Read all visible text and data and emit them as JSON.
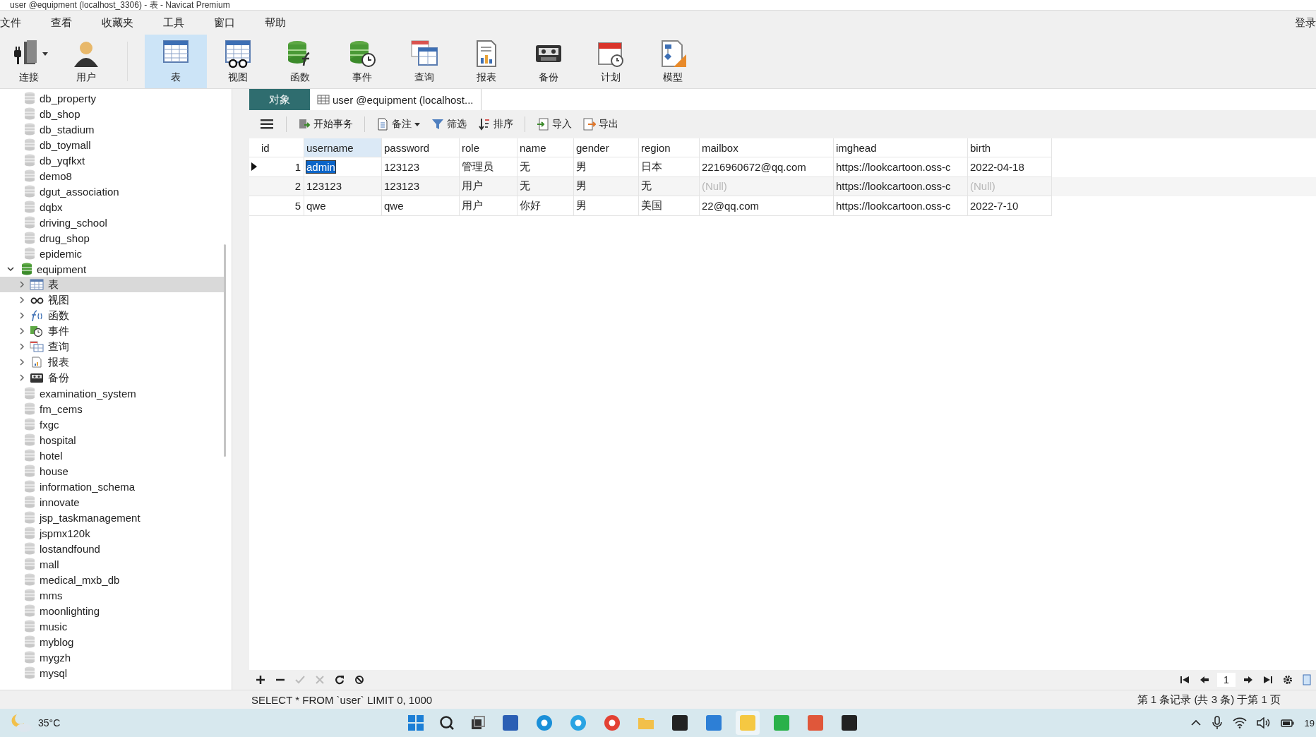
{
  "window": {
    "title": "user @equipment (localhost_3306) - 表 - Navicat Premium"
  },
  "menu": [
    "文件",
    "查看",
    "收藏夹",
    "工具",
    "窗口",
    "帮助"
  ],
  "login": "登录",
  "toolbar": [
    {
      "kind": "connect",
      "label": "连接",
      "selected": false,
      "dropdown": true
    },
    {
      "kind": "user",
      "label": "用户",
      "selected": false,
      "dropdown": false
    },
    {
      "kind": "table",
      "label": "表",
      "selected": true,
      "dropdown": false
    },
    {
      "kind": "view",
      "label": "视图",
      "selected": false,
      "dropdown": false
    },
    {
      "kind": "function",
      "label": "函数",
      "selected": false,
      "dropdown": false
    },
    {
      "kind": "event",
      "label": "事件",
      "selected": false,
      "dropdown": false
    },
    {
      "kind": "query",
      "label": "查询",
      "selected": false,
      "dropdown": false
    },
    {
      "kind": "report",
      "label": "报表",
      "selected": false,
      "dropdown": false
    },
    {
      "kind": "backup",
      "label": "备份",
      "selected": false,
      "dropdown": false
    },
    {
      "kind": "schedule",
      "label": "计划",
      "selected": false,
      "dropdown": false
    },
    {
      "kind": "model",
      "label": "模型",
      "selected": false,
      "dropdown": false
    }
  ],
  "sidebar": {
    "items": [
      {
        "label": "db_property",
        "kind": "db",
        "expanded": false,
        "selected": false
      },
      {
        "label": "db_shop",
        "kind": "db",
        "expanded": false,
        "selected": false
      },
      {
        "label": "db_stadium",
        "kind": "db",
        "expanded": false,
        "selected": false
      },
      {
        "label": "db_toymall",
        "kind": "db",
        "expanded": false,
        "selected": false
      },
      {
        "label": "db_yqfkxt",
        "kind": "db",
        "expanded": false,
        "selected": false
      },
      {
        "label": "demo8",
        "kind": "db",
        "expanded": false,
        "selected": false
      },
      {
        "label": "dgut_association",
        "kind": "db",
        "expanded": false,
        "selected": false
      },
      {
        "label": "dqbx",
        "kind": "db",
        "expanded": false,
        "selected": false
      },
      {
        "label": "driving_school",
        "kind": "db",
        "expanded": false,
        "selected": false
      },
      {
        "label": "drug_shop",
        "kind": "db",
        "expanded": false,
        "selected": false
      },
      {
        "label": "epidemic",
        "kind": "db",
        "expanded": false,
        "selected": false
      },
      {
        "label": "equipment",
        "kind": "db_open",
        "expanded": true,
        "selected": false,
        "children": [
          {
            "label": "表",
            "kind": "table",
            "expanded": false,
            "selected": true
          },
          {
            "label": "视图",
            "kind": "view",
            "expanded": false,
            "selected": false
          },
          {
            "label": "函数",
            "kind": "function",
            "expanded": false,
            "selected": false
          },
          {
            "label": "事件",
            "kind": "event",
            "expanded": false,
            "selected": false
          },
          {
            "label": "查询",
            "kind": "query",
            "expanded": false,
            "selected": false
          },
          {
            "label": "报表",
            "kind": "report",
            "expanded": false,
            "selected": false
          },
          {
            "label": "备份",
            "kind": "backup",
            "expanded": false,
            "selected": false
          }
        ]
      },
      {
        "label": "examination_system",
        "kind": "db",
        "expanded": false,
        "selected": false
      },
      {
        "label": "fm_cems",
        "kind": "db",
        "expanded": false,
        "selected": false
      },
      {
        "label": "fxgc",
        "kind": "db",
        "expanded": false,
        "selected": false
      },
      {
        "label": "hospital",
        "kind": "db",
        "expanded": false,
        "selected": false
      },
      {
        "label": "hotel",
        "kind": "db",
        "expanded": false,
        "selected": false
      },
      {
        "label": "house",
        "kind": "db",
        "expanded": false,
        "selected": false
      },
      {
        "label": "information_schema",
        "kind": "db",
        "expanded": false,
        "selected": false
      },
      {
        "label": "innovate",
        "kind": "db",
        "expanded": false,
        "selected": false
      },
      {
        "label": "jsp_taskmanagement",
        "kind": "db",
        "expanded": false,
        "selected": false
      },
      {
        "label": "jspmx120k",
        "kind": "db",
        "expanded": false,
        "selected": false
      },
      {
        "label": "lostandfound",
        "kind": "db",
        "expanded": false,
        "selected": false
      },
      {
        "label": "mall",
        "kind": "db",
        "expanded": false,
        "selected": false
      },
      {
        "label": "medical_mxb_db",
        "kind": "db",
        "expanded": false,
        "selected": false
      },
      {
        "label": "mms",
        "kind": "db",
        "expanded": false,
        "selected": false
      },
      {
        "label": "moonlighting",
        "kind": "db",
        "expanded": false,
        "selected": false
      },
      {
        "label": "music",
        "kind": "db",
        "expanded": false,
        "selected": false
      },
      {
        "label": "myblog",
        "kind": "db",
        "expanded": false,
        "selected": false
      },
      {
        "label": "mygzh",
        "kind": "db",
        "expanded": false,
        "selected": false
      },
      {
        "label": "mysql",
        "kind": "db",
        "expanded": false,
        "selected": false
      }
    ]
  },
  "tabs": [
    {
      "label": "对象",
      "kind": "objects",
      "selected": false
    },
    {
      "label": "user @equipment (localhost...",
      "kind": "table",
      "selected": true
    }
  ],
  "table_toolbar": [
    {
      "kind": "menu"
    },
    {
      "kind": "transaction",
      "label": "开始事务",
      "dropdown": false
    },
    {
      "kind": "memo",
      "label": "备注",
      "dropdown": true
    },
    {
      "kind": "filter",
      "label": "筛选",
      "dropdown": false
    },
    {
      "kind": "sort",
      "label": "排序",
      "dropdown": false
    },
    {
      "kind": "import",
      "label": "导入",
      "dropdown": false
    },
    {
      "kind": "export",
      "label": "导出",
      "dropdown": false
    }
  ],
  "table": {
    "columns": [
      {
        "label": "id",
        "selected": false
      },
      {
        "label": "username",
        "selected": true
      },
      {
        "label": "password",
        "selected": false
      },
      {
        "label": "role",
        "selected": false
      },
      {
        "label": "name",
        "selected": false
      },
      {
        "label": "gender",
        "selected": false
      },
      {
        "label": "region",
        "selected": false
      },
      {
        "label": "mailbox",
        "selected": false
      },
      {
        "label": "imghead",
        "selected": false
      },
      {
        "label": "birth",
        "selected": false
      }
    ],
    "rows": [
      {
        "selected": true,
        "cells": [
          {
            "text": "1",
            "null": false,
            "selected": false
          },
          {
            "text": "admin",
            "null": false,
            "selected": true
          },
          {
            "text": "123123",
            "null": false,
            "selected": false
          },
          {
            "text": "管理员",
            "null": false,
            "selected": false
          },
          {
            "text": "无",
            "null": false,
            "selected": false
          },
          {
            "text": "男",
            "null": false,
            "selected": false
          },
          {
            "text": "日本",
            "null": false,
            "selected": false
          },
          {
            "text": "2216960672@qq.com",
            "null": false,
            "selected": false
          },
          {
            "text": "https://lookcartoon.oss-c",
            "null": false,
            "selected": false
          },
          {
            "text": "2022-04-18",
            "null": false,
            "selected": false
          }
        ]
      },
      {
        "selected": false,
        "cells": [
          {
            "text": "2",
            "null": false,
            "selected": false
          },
          {
            "text": "123123",
            "null": false,
            "selected": false
          },
          {
            "text": "123123",
            "null": false,
            "selected": false
          },
          {
            "text": "用户",
            "null": false,
            "selected": false
          },
          {
            "text": "无",
            "null": false,
            "selected": false
          },
          {
            "text": "男",
            "null": false,
            "selected": false
          },
          {
            "text": "无",
            "null": false,
            "selected": false
          },
          {
            "text": "(Null)",
            "null": true,
            "selected": false
          },
          {
            "text": "https://lookcartoon.oss-c",
            "null": false,
            "selected": false
          },
          {
            "text": "(Null)",
            "null": true,
            "selected": false
          }
        ]
      },
      {
        "selected": false,
        "cells": [
          {
            "text": "5",
            "null": false,
            "selected": false
          },
          {
            "text": "qwe",
            "null": false,
            "selected": false
          },
          {
            "text": "qwe",
            "null": false,
            "selected": false
          },
          {
            "text": "用户",
            "null": false,
            "selected": false
          },
          {
            "text": "你好",
            "null": false,
            "selected": false
          },
          {
            "text": "男",
            "null": false,
            "selected": false
          },
          {
            "text": "美国",
            "null": false,
            "selected": false
          },
          {
            "text": "22@qq.com",
            "null": false,
            "selected": false
          },
          {
            "text": "https://lookcartoon.oss-c",
            "null": false,
            "selected": false
          },
          {
            "text": "2022-7-10",
            "null": false,
            "selected": false
          }
        ]
      }
    ]
  },
  "record_bar": {
    "left": [
      {
        "kind": "add",
        "disabled": false
      },
      {
        "kind": "remove",
        "disabled": false
      },
      {
        "kind": "apply",
        "disabled": true
      },
      {
        "kind": "discard",
        "disabled": true
      },
      {
        "kind": "refresh",
        "disabled": false
      },
      {
        "kind": "stop",
        "disabled": false
      }
    ],
    "page": "1"
  },
  "status_bar": {
    "sql": "SELECT * FROM `user` LIMIT 0, 1000",
    "records": "第 1 条记录 (共 3 条) 于第 1 页"
  },
  "taskbar": {
    "temperature": "35°C",
    "apps": [
      {
        "kind": "explorer",
        "selected": false
      },
      {
        "kind": "edge",
        "selected": false
      },
      {
        "kind": "ie",
        "selected": false
      },
      {
        "kind": "chrome",
        "selected": false
      },
      {
        "kind": "folder",
        "selected": false
      },
      {
        "kind": "ide",
        "selected": false
      },
      {
        "kind": "photos",
        "selected": false
      },
      {
        "kind": "navicat",
        "selected": true
      },
      {
        "kind": "hbuilder",
        "selected": false
      },
      {
        "kind": "slides",
        "selected": false
      },
      {
        "kind": "terminal",
        "selected": false
      }
    ],
    "clock": "19"
  }
}
